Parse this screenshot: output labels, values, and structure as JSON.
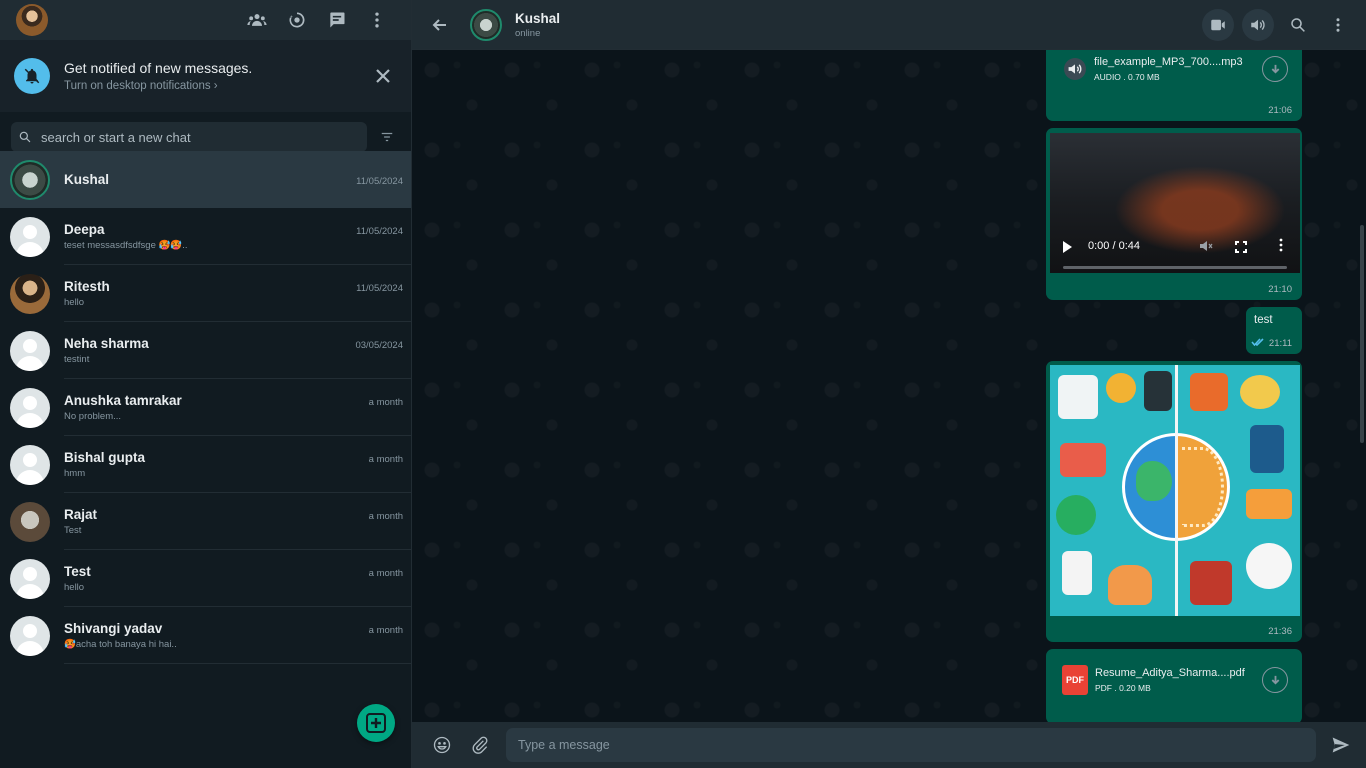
{
  "sidebar": {
    "notification": {
      "title": "Get notified of new messages.",
      "subtitle": "Turn on desktop notifications ›"
    },
    "search": {
      "placeholder": "search or start a new chat"
    },
    "chats": [
      {
        "name": "Kushal",
        "preview": "",
        "time": "11/05/2024",
        "active": true
      },
      {
        "name": "Deepa",
        "preview": " teset messasdfsdfsge 🥵🥵..",
        "time": "11/05/2024"
      },
      {
        "name": "Ritesth",
        "preview": "hello",
        "time": "11/05/2024"
      },
      {
        "name": "Neha sharma",
        "preview": " testint",
        "time": "03/05/2024"
      },
      {
        "name": "Anushka tamrakar",
        "preview": "No problem...",
        "time": "a month"
      },
      {
        "name": "Bishal gupta",
        "preview": " hmm",
        "time": "a month"
      },
      {
        "name": "Rajat",
        "preview": "Test",
        "time": "a month"
      },
      {
        "name": "Test",
        "preview": "hello",
        "time": "a month"
      },
      {
        "name": "Shivangi yadav",
        "preview": "🥵acha toh banaya hi hai..",
        "time": "a month"
      }
    ]
  },
  "conversation": {
    "contact_name": "Kushal",
    "contact_status": "online",
    "messages": {
      "audio": {
        "file_name": "file_example_MP3_700....mp3",
        "file_meta": "AUDIO . 0.70 MB",
        "time": "21:06"
      },
      "video": {
        "player_time": "0:00 / 0:44",
        "time": "21:10"
      },
      "text": {
        "body": "test",
        "time": "21:11"
      },
      "image": {
        "time": "21:36"
      },
      "pdf": {
        "badge": "PDF",
        "file_name": "Resume_Aditya_Sharma....pdf",
        "file_meta": "PDF . 0.20 MB"
      }
    },
    "composer": {
      "placeholder": "Type a message"
    }
  },
  "colors": {
    "accent": "#00a884",
    "outgoing_bubble": "#005c4b",
    "panel": "#202c33",
    "background": "#111b21",
    "read_ticks": "#53bdeb"
  },
  "icons": {
    "header": [
      "communities-icon",
      "status-icon",
      "new-chat-icon",
      "menu-icon"
    ],
    "conversation_header": [
      "video-call-icon",
      "speaker-icon",
      "search-icon",
      "menu-icon"
    ],
    "composer": [
      "emoji-icon",
      "attach-icon",
      "send-icon"
    ]
  }
}
